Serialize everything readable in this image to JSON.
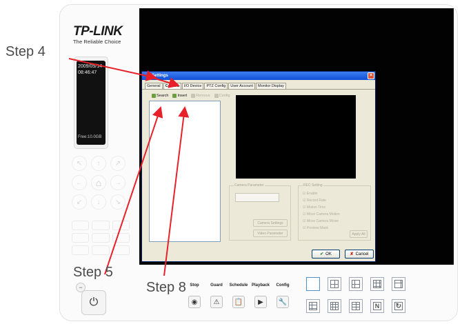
{
  "brand": {
    "name": "TP-LINK",
    "tagline": "The Reliable Choice"
  },
  "phone_display": {
    "date": "2009/05/14",
    "time": "08:46:47",
    "free": "Free:10.0GB"
  },
  "dialog": {
    "title": "Settings",
    "tabs": [
      "General",
      "Camera",
      "I/O Device",
      "PTZ Config",
      "User Account",
      "Monitor Display"
    ],
    "toolbar": {
      "search": "Search",
      "insert": "Insert",
      "remove": "Remove",
      "config": "Config"
    },
    "camera_param": {
      "label": "Camera Parameter",
      "settings_btn": "Camera Settings",
      "video_btn": "Video Parameter"
    },
    "rec_setting": {
      "label": "REC Setting",
      "enable": "Enable",
      "record_rate": "Record Rate",
      "motion_time": "Motion Time",
      "motion_detect": "Move Camera Motion",
      "move_record": "Move Camera Movie",
      "mask": "Preview Mask",
      "apply_btn": "Apply All"
    },
    "ok_label": "OK",
    "cancel_label": "Cancel"
  },
  "modes": [
    "Stop",
    "Guard",
    "Schedule",
    "Playback",
    "Config"
  ],
  "steps": {
    "s4": "Step 4",
    "s5": "Step 5",
    "s8": "Step 8"
  },
  "colors": {
    "arrow": "#e8202a",
    "title_bar": "#1150d8",
    "dialog_bg": "#ece9d8",
    "video_bg": "#020202"
  }
}
